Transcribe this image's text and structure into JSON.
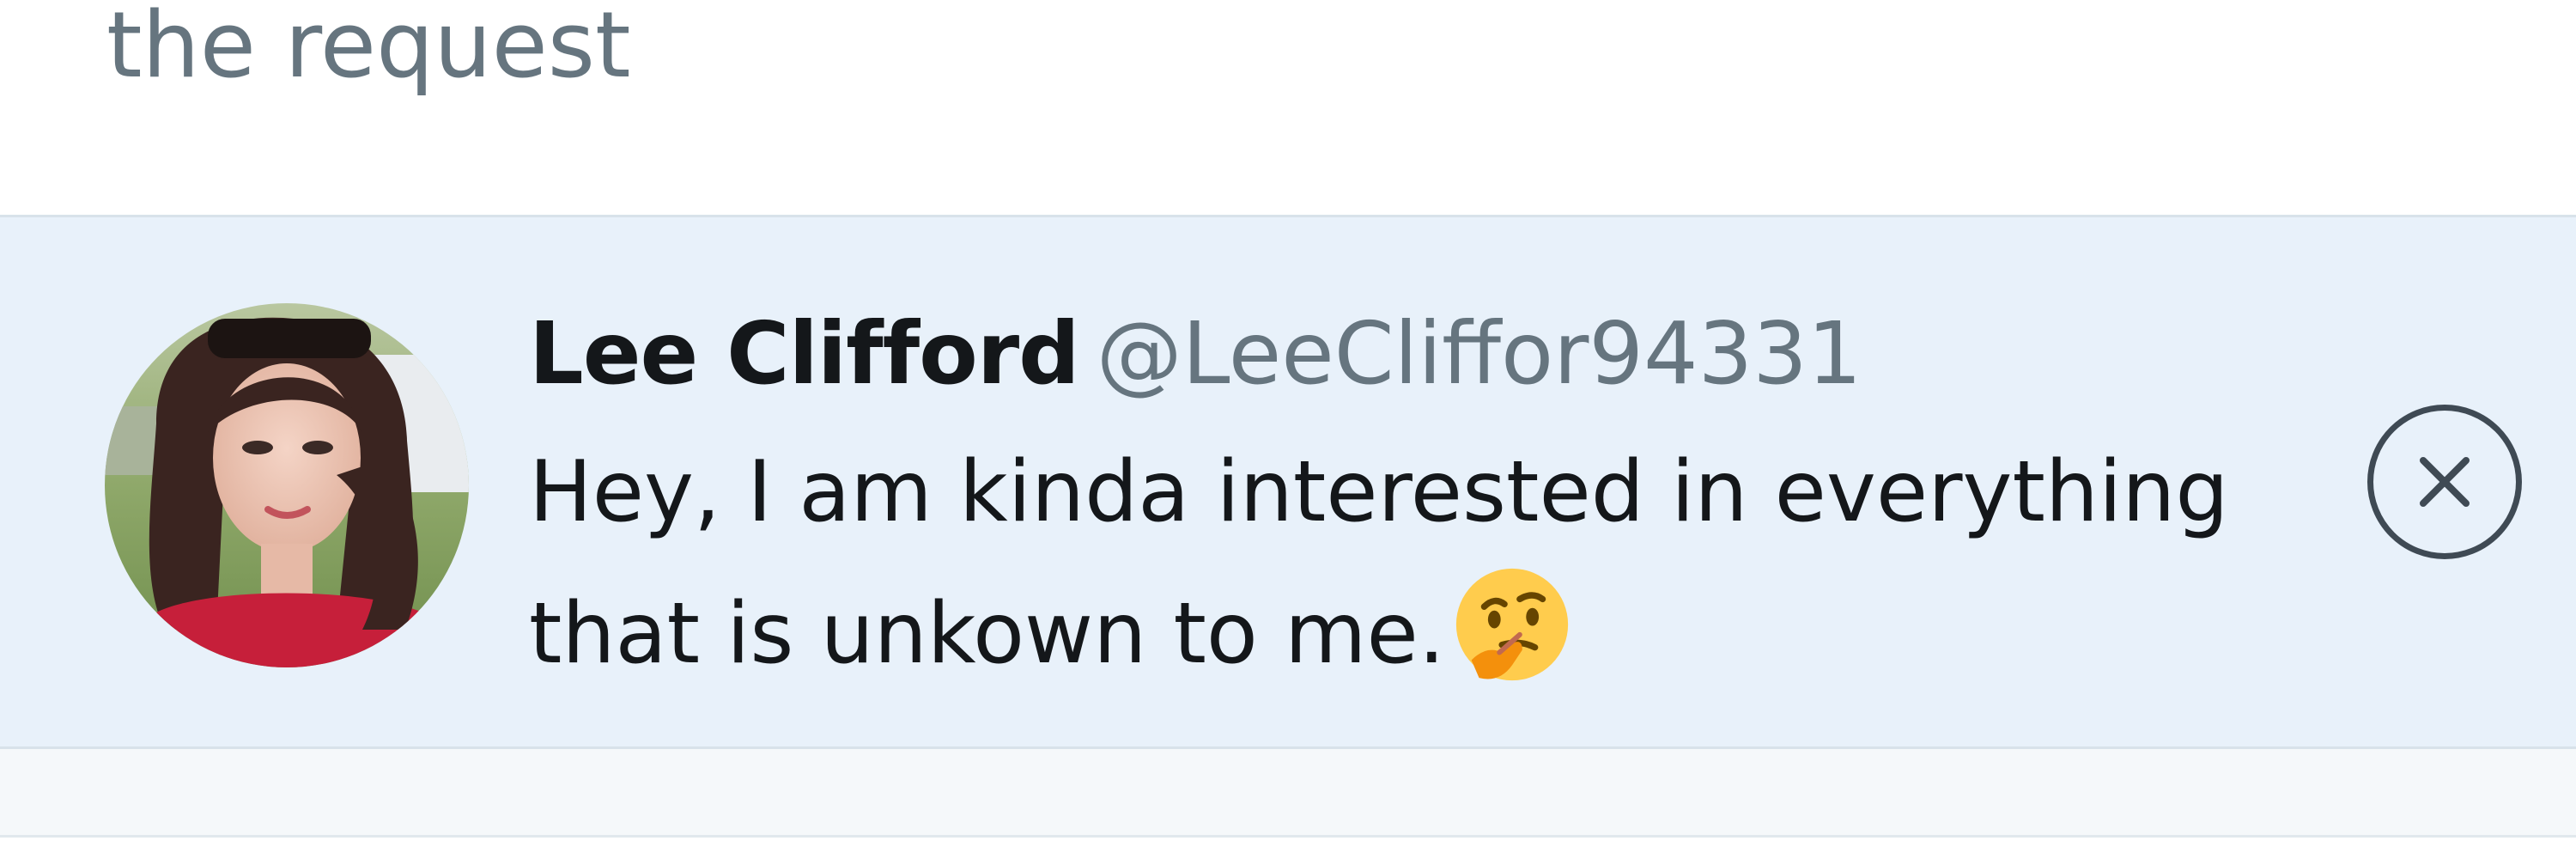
{
  "previous_reply": {
    "text": "the request"
  },
  "notification": {
    "display_name": "Lee Clifford",
    "handle": "@LeeCliffor94331",
    "message": "Hey, I am kinda interested in everything that is unkown to me.",
    "emoji": "thinking-face-icon",
    "avatar": "profile-photo",
    "close_icon": "close-icon"
  },
  "colors": {
    "notification_background": "#e8f1fa",
    "handle_text": "#66757f",
    "name_text": "#14171a",
    "close_icon_stroke": "#3f4a54"
  }
}
